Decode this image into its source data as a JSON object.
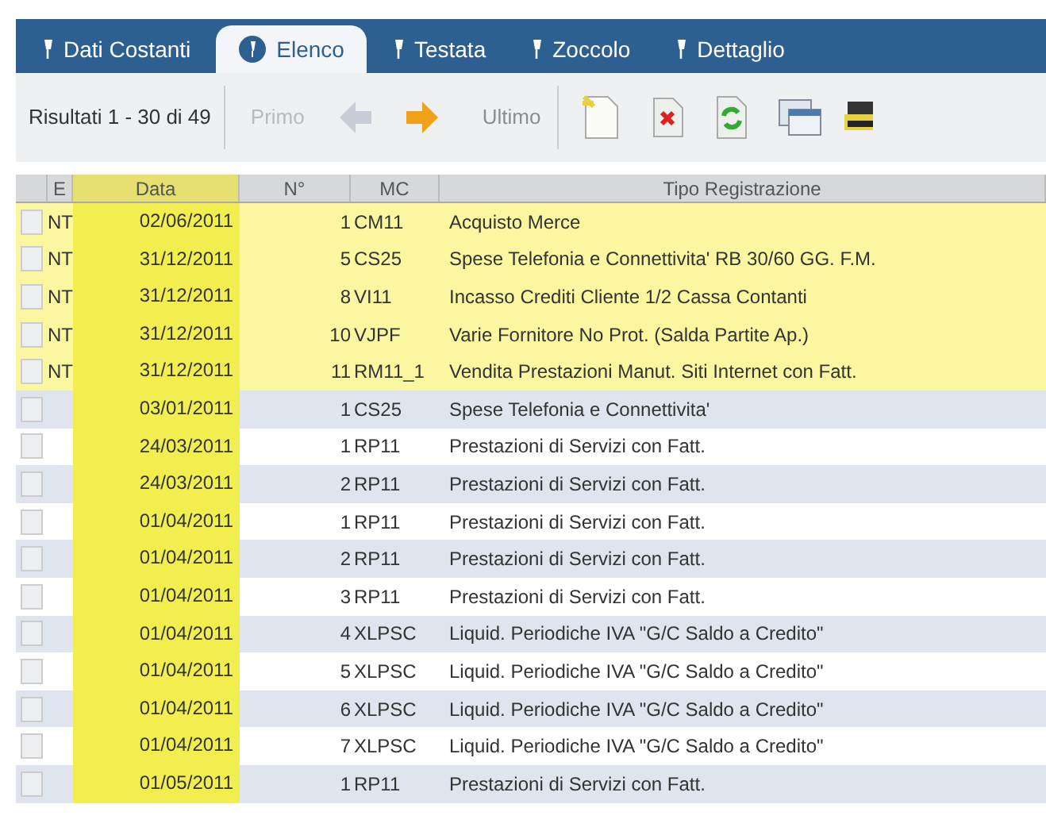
{
  "tabs": [
    {
      "label": "Dati Costanti",
      "selected": false
    },
    {
      "label": "Elenco",
      "selected": true
    },
    {
      "label": "Testata",
      "selected": false
    },
    {
      "label": "Zoccolo",
      "selected": false
    },
    {
      "label": "Dettaglio",
      "selected": false
    }
  ],
  "toolbar": {
    "results": "Risultati 1 - 30 di 49",
    "first": {
      "label": "Primo",
      "disabled": true
    },
    "previous": {
      "disabled": true
    },
    "next": {
      "disabled": false
    },
    "last": {
      "label": "Ultimo",
      "disabled": false
    }
  },
  "table": {
    "columns": [
      "E",
      "Data",
      "N°",
      "MC",
      "Tipo Registrazione"
    ],
    "rows": [
      {
        "e": "NT",
        "data": "02/06/2011",
        "numero": "1",
        "mc": "CM11",
        "tipo": "Acquisto Merce",
        "highlighted": true
      },
      {
        "e": "NT",
        "data": "31/12/2011",
        "numero": "5",
        "mc": "CS25",
        "tipo": "Spese Telefonia e Connettivita' RB 30/60 GG. F.M.",
        "highlighted": true
      },
      {
        "e": "NT",
        "data": "31/12/2011",
        "numero": "8",
        "mc": "VI11",
        "tipo": "Incasso Crediti Cliente 1/2 Cassa Contanti",
        "highlighted": true
      },
      {
        "e": "NT",
        "data": "31/12/2011",
        "numero": "10",
        "mc": "VJPF",
        "tipo": "Varie Fornitore No Prot. (Salda Partite Ap.)",
        "highlighted": true
      },
      {
        "e": "NT",
        "data": "31/12/2011",
        "numero": "11",
        "mc": "RM11_1",
        "tipo": "Vendita Prestazioni Manut. Siti Internet con Fatt.",
        "highlighted": true
      },
      {
        "data": "03/01/2011",
        "numero": "1",
        "mc": "CS25",
        "tipo": "Spese Telefonia e Connettivita'",
        "highlighted": false
      },
      {
        "data": "24/03/2011",
        "numero": "1",
        "mc": "RP11",
        "tipo": "Prestazioni di Servizi con Fatt.",
        "highlighted": false
      },
      {
        "data": "24/03/2011",
        "numero": "2",
        "mc": "RP11",
        "tipo": "Prestazioni di Servizi con Fatt.",
        "highlighted": false
      },
      {
        "data": "01/04/2011",
        "numero": "1",
        "mc": "RP11",
        "tipo": "Prestazioni di Servizi con Fatt.",
        "highlighted": false
      },
      {
        "data": "01/04/2011",
        "numero": "2",
        "mc": "RP11",
        "tipo": "Prestazioni di Servizi con Fatt.",
        "highlighted": false
      },
      {
        "data": "01/04/2011",
        "numero": "3",
        "mc": "RP11",
        "tipo": "Prestazioni di Servizi con Fatt.",
        "highlighted": false
      },
      {
        "data": "01/04/2011",
        "numero": "4",
        "mc": "XLPSC",
        "tipo": "Liquid. Periodiche IVA \"G/C Saldo a Credito\"",
        "highlighted": false
      },
      {
        "data": "01/04/2011",
        "numero": "5",
        "mc": "XLPSC",
        "tipo": "Liquid. Periodiche IVA \"G/C Saldo a Credito\"",
        "highlighted": false
      },
      {
        "data": "01/04/2011",
        "numero": "6",
        "mc": "XLPSC",
        "tipo": "Liquid. Periodiche IVA \"G/C Saldo a Credito\"",
        "highlighted": false
      },
      {
        "data": "01/04/2011",
        "numero": "7",
        "mc": "XLPSC",
        "tipo": "Liquid. Periodiche IVA \"G/C Saldo a Credito\"",
        "highlighted": false
      },
      {
        "data": "01/05/2011",
        "numero": "1",
        "mc": "RP11",
        "tipo": "Prestazioni di Servizi con Fatt.",
        "highlighted": false
      }
    ]
  }
}
